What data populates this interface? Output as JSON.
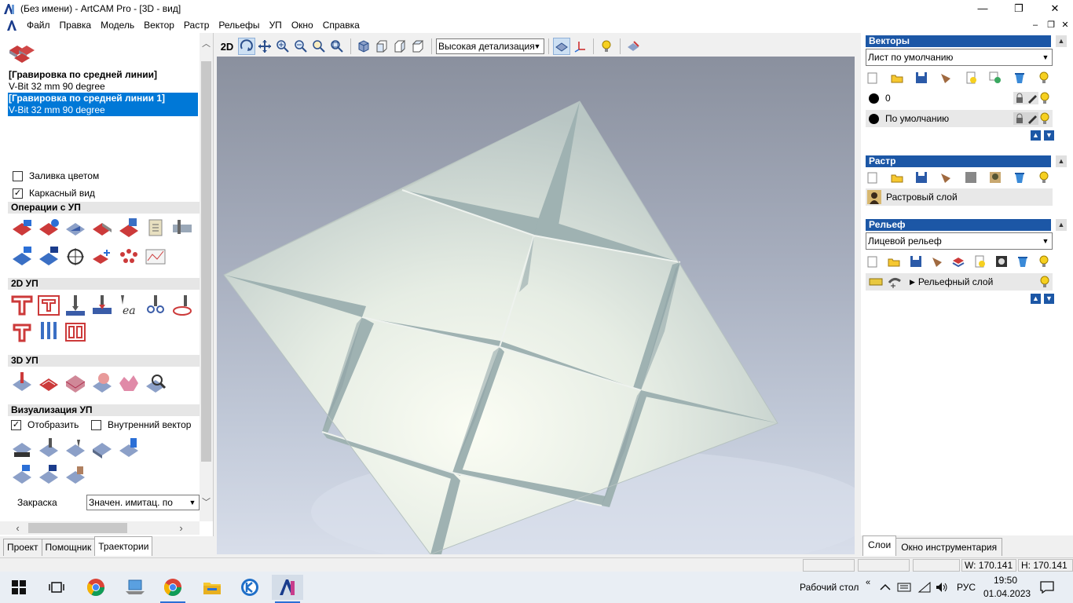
{
  "window": {
    "title": "(Без имени) - ArtCAM Pro - [3D - вид]",
    "app_icon": "artcam-icon",
    "minimize": "—",
    "maximize": "❐",
    "close": "✕"
  },
  "menu": {
    "items": [
      "Файл",
      "Правка",
      "Модель",
      "Вектор",
      "Растр",
      "Рельефы",
      "УП",
      "Окно",
      "Справка"
    ],
    "mdi_minimize": "–",
    "mdi_restore": "❐",
    "mdi_close": "✕"
  },
  "toolpaths_panel": {
    "list": [
      {
        "label": "[Гравировка по средней линии]",
        "bold": true,
        "selected": false
      },
      {
        "label": "V-Bit 32 mm 90 degree",
        "bold": false,
        "selected": false
      },
      {
        "label": "[Гравировка по средней линии 1]",
        "bold": true,
        "selected": true
      },
      {
        "label": "V-Bit 32 mm 90 degree",
        "bold": false,
        "selected": true
      }
    ],
    "fill_color": {
      "label": "Заливка цветом",
      "checked": false
    },
    "wireframe": {
      "label": "Каркасный вид",
      "checked": true
    },
    "sections": {
      "toolpath_ops": "Операции с УП",
      "toolpaths_2d": "2D УП",
      "toolpaths_3d": "3D УП",
      "toolpath_vis": "Визуализация УП"
    },
    "vis": {
      "show": {
        "label": "Отобразить",
        "checked": true
      },
      "inner_vector": {
        "label": "Внутренний вектор",
        "checked": false
      }
    },
    "shading": {
      "label": "Закраска",
      "value": "Значен. имитац. по"
    }
  },
  "left_tabs": [
    "Проект",
    "Помощник",
    "Траектории"
  ],
  "left_tabs_active": 2,
  "viewport_toolbar": {
    "two_d": "2D",
    "detail_level": "Высокая детализация"
  },
  "vectors": {
    "title": "Векторы",
    "sheet": "Лист по умолчанию",
    "layers": [
      {
        "name": "0",
        "highlighted": false
      },
      {
        "name": "По умолчанию",
        "highlighted": true
      }
    ]
  },
  "bitmap": {
    "title": "Растр",
    "layers": [
      {
        "name": "Растровый слой"
      }
    ]
  },
  "relief": {
    "title": "Рельеф",
    "selected": "Лицевой рельеф",
    "layers": [
      {
        "name": "Рельефный слой"
      }
    ]
  },
  "right_tabs": [
    "Слои",
    "Окно инструментария"
  ],
  "right_tabs_active": 0,
  "status": {
    "width": "W: 170.141",
    "height": "H: 170.141"
  },
  "taskbar": {
    "desktop_label": "Рабочий стол",
    "chevron": "«",
    "lang": "РУС",
    "time": "19:50",
    "date": "01.04.2023"
  }
}
